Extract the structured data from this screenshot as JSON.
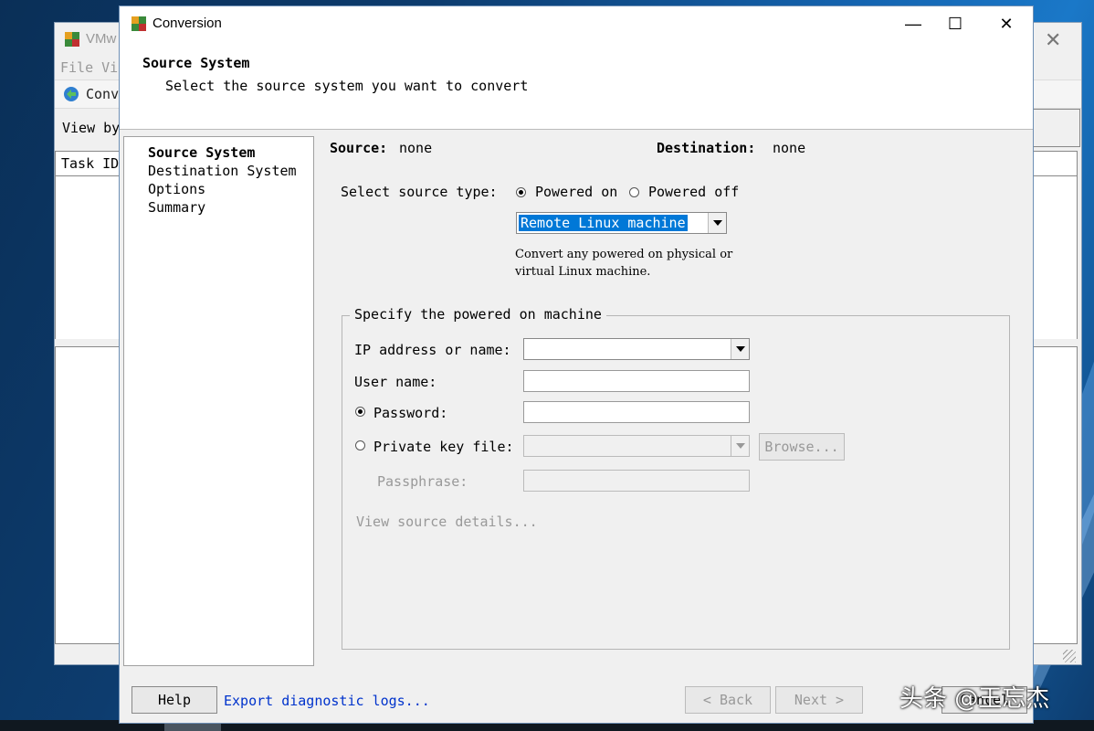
{
  "background_window": {
    "title": "VMw",
    "menu": "File  Vi",
    "toolbar_label": "Conv",
    "view_by": "View by",
    "column_task_id": "Task ID"
  },
  "dialog": {
    "title": "Conversion",
    "header": {
      "title": "Source System",
      "subtitle": "Select the source system you want to convert"
    },
    "nav": [
      "Source System",
      "Destination System",
      "Options",
      "Summary"
    ],
    "source_label": "Source:",
    "source_value": "none",
    "destination_label": "Destination:",
    "destination_value": "none",
    "source_type_label": "Select source type:",
    "powered_on": "Powered on",
    "powered_off": "Powered off",
    "machine_type": "Remote Linux machine",
    "description_line1": "Convert any powered on physical or",
    "description_line2": "virtual Linux machine.",
    "group_title": "Specify the powered on machine",
    "ip_label": "IP address or name:",
    "user_label": "User name:",
    "password_label": "Password:",
    "key_label": "Private key file:",
    "browse": "Browse...",
    "passphrase_label": "Passphrase:",
    "view_details": "View source details...",
    "help": "Help",
    "export_logs": "Export diagnostic logs...",
    "back": "< Back",
    "next": "Next >",
    "cancel": "Cancel"
  },
  "watermark": "头条 @王忘杰"
}
